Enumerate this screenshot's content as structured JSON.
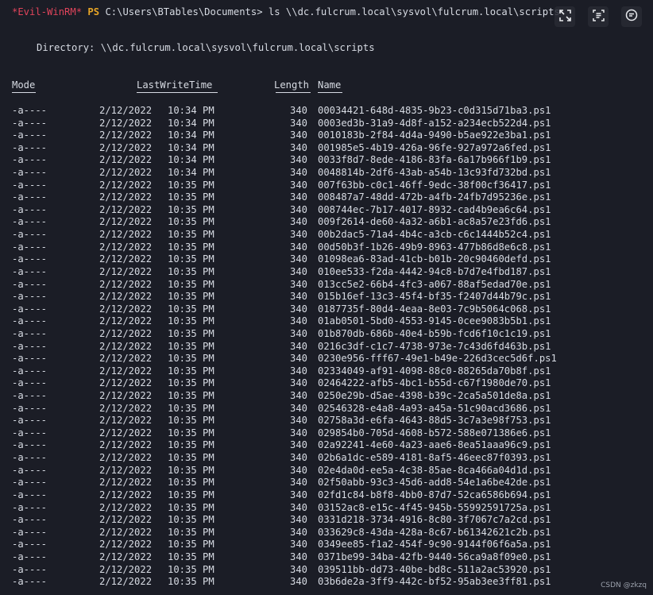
{
  "prompt": {
    "tag": "*Evil-WinRM*",
    "shell": "PS",
    "command": "C:\\Users\\BTables\\Documents> ls \\\\dc.fulcrum.local\\sysvol\\fulcrum.local\\scripts"
  },
  "directory_line": "Directory: \\\\dc.fulcrum.local\\sysvol\\fulcrum.local\\scripts",
  "headers": {
    "mode": "Mode",
    "lastwritetime": "LastWriteTime",
    "length": "Length",
    "name": "Name"
  },
  "rows": [
    {
      "mode": "-a----",
      "date": "2/12/2022",
      "time": "10:34 PM",
      "length": "340",
      "name": "00034421-648d-4835-9b23-c0d315d71ba3.ps1"
    },
    {
      "mode": "-a----",
      "date": "2/12/2022",
      "time": "10:34 PM",
      "length": "340",
      "name": "0003ed3b-31a9-4d8f-a152-a234ecb522d4.ps1"
    },
    {
      "mode": "-a----",
      "date": "2/12/2022",
      "time": "10:34 PM",
      "length": "340",
      "name": "0010183b-2f84-4d4a-9490-b5ae922e3ba1.ps1"
    },
    {
      "mode": "-a----",
      "date": "2/12/2022",
      "time": "10:34 PM",
      "length": "340",
      "name": "001985e5-4b19-426a-96fe-927a972a6fed.ps1"
    },
    {
      "mode": "-a----",
      "date": "2/12/2022",
      "time": "10:34 PM",
      "length": "340",
      "name": "0033f8d7-8ede-4186-83fa-6a17b966f1b9.ps1"
    },
    {
      "mode": "-a----",
      "date": "2/12/2022",
      "time": "10:34 PM",
      "length": "340",
      "name": "0048814b-2df6-43ab-a54b-13c93fd732bd.ps1"
    },
    {
      "mode": "-a----",
      "date": "2/12/2022",
      "time": "10:35 PM",
      "length": "340",
      "name": "007f63bb-c0c1-46ff-9edc-38f00cf36417.ps1"
    },
    {
      "mode": "-a----",
      "date": "2/12/2022",
      "time": "10:35 PM",
      "length": "340",
      "name": "008487a7-48dd-472b-a4fb-24fb7d95236e.ps1"
    },
    {
      "mode": "-a----",
      "date": "2/12/2022",
      "time": "10:35 PM",
      "length": "340",
      "name": "008744ec-7b17-4017-8932-cad4b9ea6c64.ps1"
    },
    {
      "mode": "-a----",
      "date": "2/12/2022",
      "time": "10:35 PM",
      "length": "340",
      "name": "009f2614-de60-4a32-a6b1-ac8a57e23fd6.ps1"
    },
    {
      "mode": "-a----",
      "date": "2/12/2022",
      "time": "10:35 PM",
      "length": "340",
      "name": "00b2dac5-71a4-4b4c-a3cb-c6c1444b52c4.ps1"
    },
    {
      "mode": "-a----",
      "date": "2/12/2022",
      "time": "10:35 PM",
      "length": "340",
      "name": "00d50b3f-1b26-49b9-8963-477b86d8e6c8.ps1"
    },
    {
      "mode": "-a----",
      "date": "2/12/2022",
      "time": "10:35 PM",
      "length": "340",
      "name": "01098ea6-83ad-41cb-b01b-20c90460defd.ps1"
    },
    {
      "mode": "-a----",
      "date": "2/12/2022",
      "time": "10:35 PM",
      "length": "340",
      "name": "010ee533-f2da-4442-94c8-b7d7e4fbd187.ps1"
    },
    {
      "mode": "-a----",
      "date": "2/12/2022",
      "time": "10:35 PM",
      "length": "340",
      "name": "013cc5e2-66b4-4fc3-a067-88af5edad70e.ps1"
    },
    {
      "mode": "-a----",
      "date": "2/12/2022",
      "time": "10:35 PM",
      "length": "340",
      "name": "015b16ef-13c3-45f4-bf35-f2407d44b79c.ps1"
    },
    {
      "mode": "-a----",
      "date": "2/12/2022",
      "time": "10:35 PM",
      "length": "340",
      "name": "0187735f-80d4-4eaa-8e03-7c9b5064c068.ps1"
    },
    {
      "mode": "-a----",
      "date": "2/12/2022",
      "time": "10:35 PM",
      "length": "340",
      "name": "01ab0501-5bd0-4553-9145-0cee9083b5b1.ps1"
    },
    {
      "mode": "-a----",
      "date": "2/12/2022",
      "time": "10:35 PM",
      "length": "340",
      "name": "01b870db-686b-40e4-b59b-fcd6f10c1c19.ps1"
    },
    {
      "mode": "-a----",
      "date": "2/12/2022",
      "time": "10:35 PM",
      "length": "340",
      "name": "0216c3df-c1c7-4738-973e-7c43d6fd463b.ps1"
    },
    {
      "mode": "-a----",
      "date": "2/12/2022",
      "time": "10:35 PM",
      "length": "340",
      "name": "0230e956-fff67-49e1-b49e-226d3cec5d6f.ps1"
    },
    {
      "mode": "-a----",
      "date": "2/12/2022",
      "time": "10:35 PM",
      "length": "340",
      "name": "02334049-af91-4098-88c0-88265da70b8f.ps1"
    },
    {
      "mode": "-a----",
      "date": "2/12/2022",
      "time": "10:35 PM",
      "length": "340",
      "name": "02464222-afb5-4bc1-b55d-c67f1980de70.ps1"
    },
    {
      "mode": "-a----",
      "date": "2/12/2022",
      "time": "10:35 PM",
      "length": "340",
      "name": "0250e29b-d5ae-4398-b39c-2ca5a501de8a.ps1"
    },
    {
      "mode": "-a----",
      "date": "2/12/2022",
      "time": "10:35 PM",
      "length": "340",
      "name": "02546328-e4a8-4a93-a45a-51c90acd3686.ps1"
    },
    {
      "mode": "-a----",
      "date": "2/12/2022",
      "time": "10:35 PM",
      "length": "340",
      "name": "02758a3d-e6fa-4643-88d5-3c7a3e98f753.ps1"
    },
    {
      "mode": "-a----",
      "date": "2/12/2022",
      "time": "10:35 PM",
      "length": "340",
      "name": "029854b0-705d-4608-b572-588e071386e6.ps1"
    },
    {
      "mode": "-a----",
      "date": "2/12/2022",
      "time": "10:35 PM",
      "length": "340",
      "name": "02a92241-4e60-4a23-aae6-8ea51aaa96c9.ps1"
    },
    {
      "mode": "-a----",
      "date": "2/12/2022",
      "time": "10:35 PM",
      "length": "340",
      "name": "02b6a1dc-e589-4181-8af5-46eec87f0393.ps1"
    },
    {
      "mode": "-a----",
      "date": "2/12/2022",
      "time": "10:35 PM",
      "length": "340",
      "name": "02e4da0d-ee5a-4c38-85ae-8ca466a04d1d.ps1"
    },
    {
      "mode": "-a----",
      "date": "2/12/2022",
      "time": "10:35 PM",
      "length": "340",
      "name": "02f50abb-93c3-45d6-add8-54e1a6be42de.ps1"
    },
    {
      "mode": "-a----",
      "date": "2/12/2022",
      "time": "10:35 PM",
      "length": "340",
      "name": "02fd1c84-b8f8-4bb0-87d7-52ca6586b694.ps1"
    },
    {
      "mode": "-a----",
      "date": "2/12/2022",
      "time": "10:35 PM",
      "length": "340",
      "name": "03152ac8-e15c-4f45-945b-55992591725a.ps1"
    },
    {
      "mode": "-a----",
      "date": "2/12/2022",
      "time": "10:35 PM",
      "length": "340",
      "name": "0331d218-3734-4916-8c80-3f7067c7a2cd.ps1"
    },
    {
      "mode": "-a----",
      "date": "2/12/2022",
      "time": "10:35 PM",
      "length": "340",
      "name": "033629c8-43da-428a-8c67-b61342621c2b.ps1"
    },
    {
      "mode": "-a----",
      "date": "2/12/2022",
      "time": "10:35 PM",
      "length": "340",
      "name": "0349ee85-f1a2-454f-9c90-9144f06f6a5a.ps1"
    },
    {
      "mode": "-a----",
      "date": "2/12/2022",
      "time": "10:35 PM",
      "length": "340",
      "name": "0371be99-34ba-42fb-9440-56ca9a8f09e0.ps1"
    },
    {
      "mode": "-a----",
      "date": "2/12/2022",
      "time": "10:35 PM",
      "length": "340",
      "name": "039511bb-dd73-40be-bd8c-511a2ac53920.ps1"
    },
    {
      "mode": "-a----",
      "date": "2/12/2022",
      "time": "10:35 PM",
      "length": "340",
      "name": "03b6de2a-3ff9-442c-bf52-95ab3ee3ff81.ps1"
    }
  ],
  "toolbar": {
    "expand_icon": "expand-icon",
    "ocr_icon": "text-scan-icon",
    "comment_icon": "comment-icon"
  },
  "watermark": "CSDN @zkzq",
  "colors": {
    "background": "#1b1d26",
    "text": "#d7dbe3",
    "evil_tag": "#e0445b",
    "ps": "#e7a526"
  }
}
